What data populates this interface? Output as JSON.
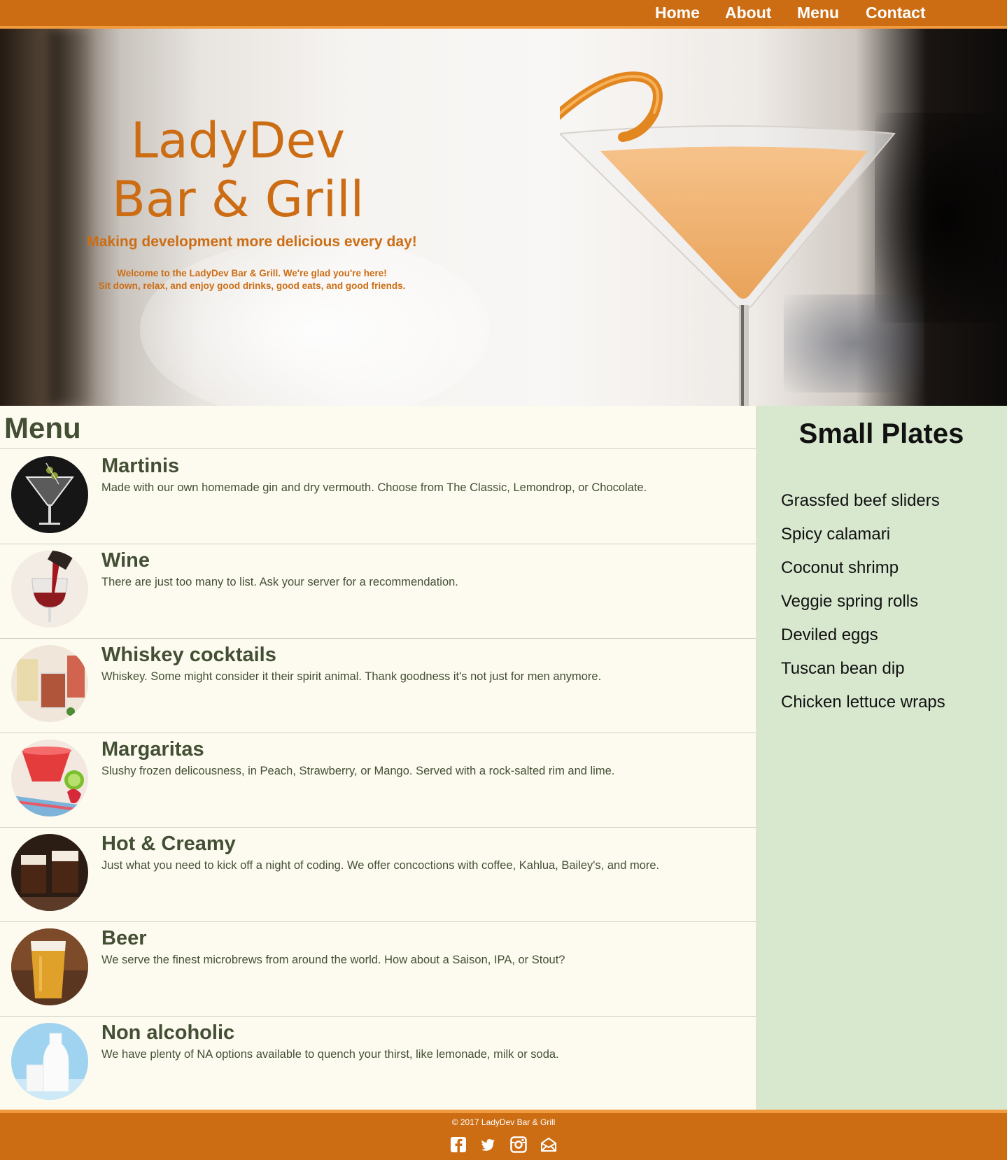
{
  "nav": {
    "items": [
      {
        "label": "Home"
      },
      {
        "label": "About"
      },
      {
        "label": "Menu"
      },
      {
        "label": "Contact"
      }
    ]
  },
  "hero": {
    "title_line1": "LadyDev",
    "title_line2": "Bar & Grill",
    "tagline": "Making development more delicious every day!",
    "welcome_line1": "Welcome to the LadyDev Bar & Grill.  We're glad you're here!",
    "welcome_line2": "Sit down, relax, and enjoy good drinks, good eats, and good friends."
  },
  "menu": {
    "heading": "Menu",
    "items": [
      {
        "name": "Martinis",
        "description": "Made with our own homemade gin and dry vermouth.  Choose from The Classic, Lemondrop, or Chocolate.",
        "thumb": "martini-glass-icon"
      },
      {
        "name": "Wine",
        "description": "There are just too many to list.  Ask your server for a recommendation.",
        "thumb": "wine-glass-icon"
      },
      {
        "name": "Whiskey cocktails",
        "description": "Whiskey.  Some might consider it their spirit animal.  Thank goodness it's not just for men anymore.",
        "thumb": "whiskey-glass-icon"
      },
      {
        "name": "Margaritas",
        "description": "Slushy frozen delicousness, in Peach, Strawberry, or Mango.  Served with a rock-salted rim and lime.",
        "thumb": "margarita-glass-icon"
      },
      {
        "name": "Hot & Creamy",
        "description": "Just what you need to kick off a night of coding.  We offer concoctions with coffee, Kahlua, Bailey's, and more.",
        "thumb": "irish-coffee-icon"
      },
      {
        "name": "Beer",
        "description": "We serve the finest microbrews from around the world.  How about a Saison, IPA, or Stout?",
        "thumb": "beer-glass-icon"
      },
      {
        "name": "Non alcoholic",
        "description": "We have plenty of NA options available to quench your thirst, like lemonade, milk or soda.",
        "thumb": "milk-bottle-icon"
      }
    ]
  },
  "sidebar": {
    "heading": "Small Plates",
    "items": [
      "Grassfed beef sliders",
      "Spicy calamari",
      "Coconut shrimp",
      "Veggie spring rolls",
      "Deviled eggs",
      "Tuscan bean dip",
      "Chicken lettuce wraps"
    ]
  },
  "footer": {
    "copyright": "© 2017 LadyDev Bar & Grill",
    "social": [
      "facebook-icon",
      "twitter-icon",
      "instagram-icon",
      "email-icon"
    ]
  },
  "colors": {
    "brand_orange": "#cc6d14",
    "accent_orange": "#f29a3e",
    "text_green": "#434f35",
    "sidebar_green": "#d8e8cf",
    "cream": "#fdfbef"
  }
}
